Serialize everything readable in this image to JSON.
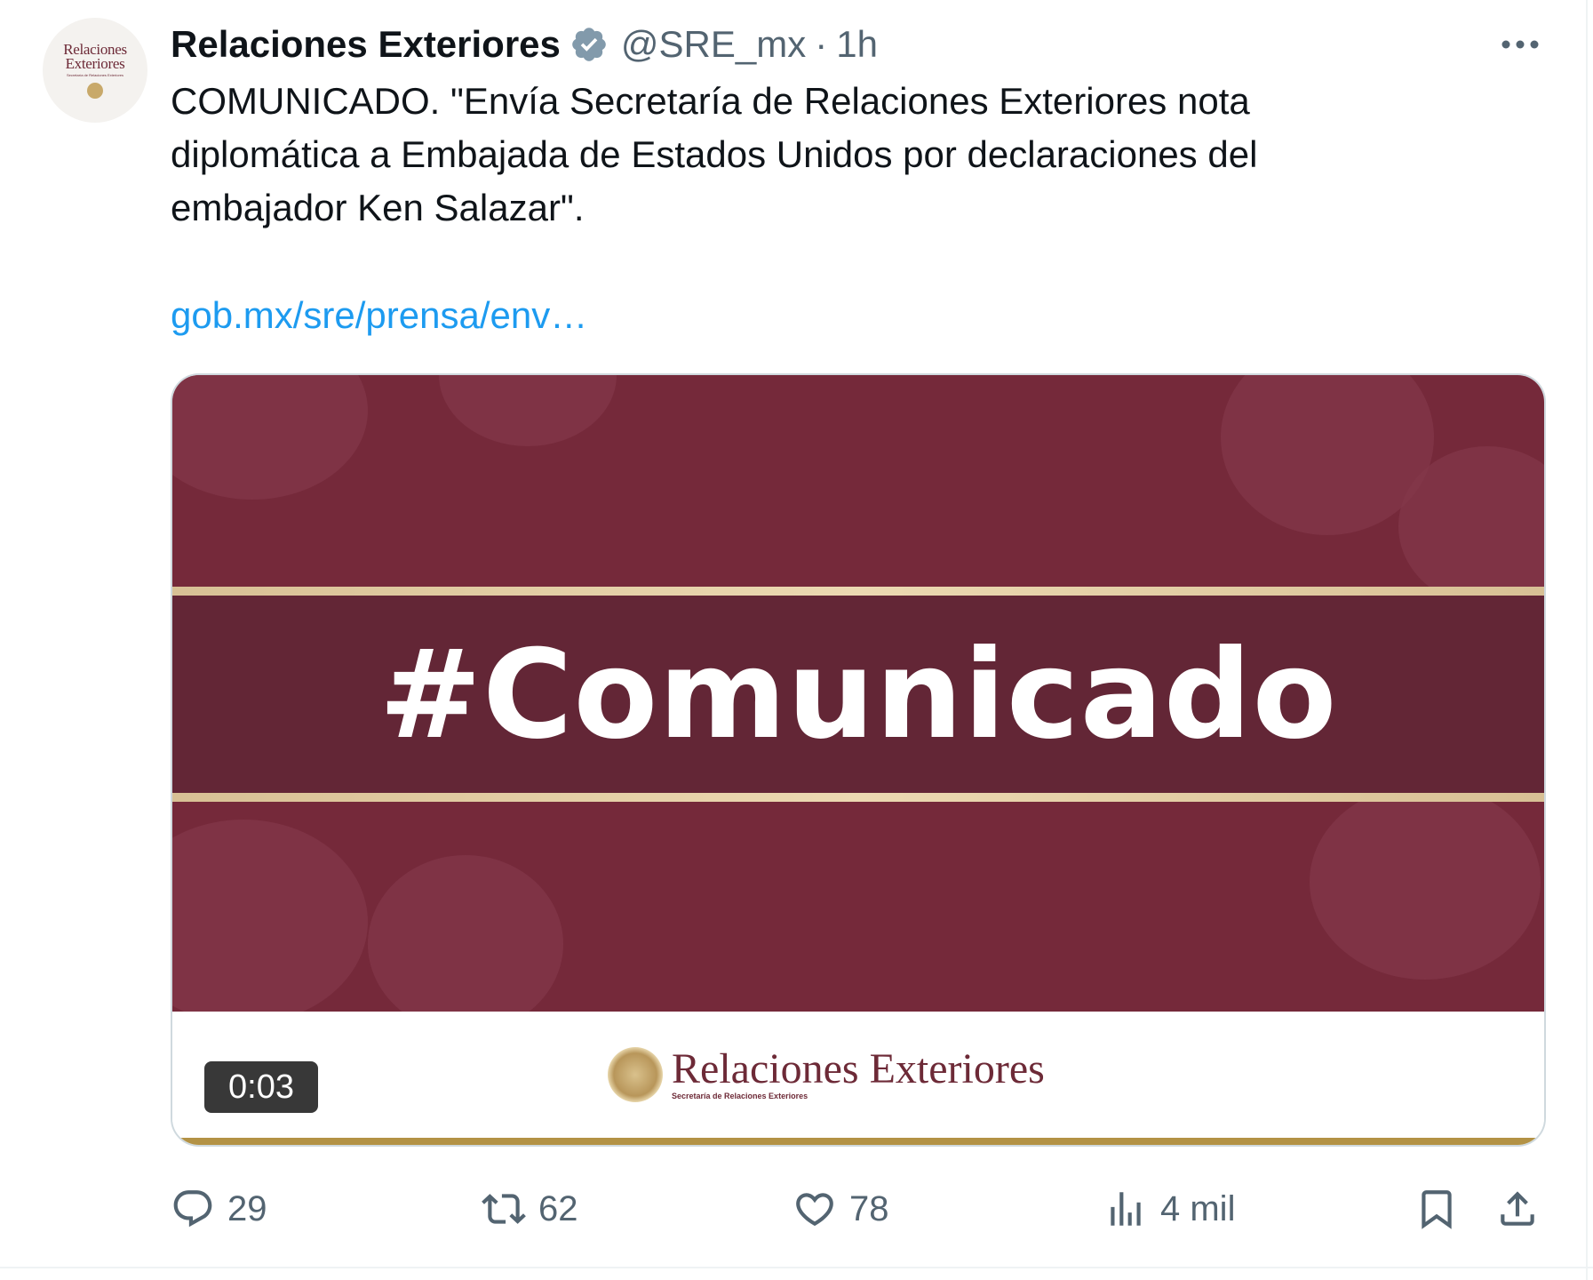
{
  "tweet": {
    "avatar": {
      "line1": "Relaciones",
      "line2": "Exteriores",
      "subtitle": "Secretaría de Relaciones Exteriores"
    },
    "display_name": "Relaciones Exteriores",
    "verified_icon": "verified-badge-icon",
    "handle": "@SRE_mx",
    "separator": "·",
    "time": "1h",
    "more_icon": "more-icon",
    "text": "COMUNICADO. \"Envía Secretaría de Relaciones Exteriores nota diplomática a Embajada de Estados Unidos por declaraciones del embajador Ken Salazar\".",
    "link": "gob.mx/sre/prensa/env…"
  },
  "media": {
    "headline": "#Comunicado",
    "brand_name": "Relaciones Exteriores",
    "brand_sub": "Secretaría de Relaciones Exteriores",
    "timer": "0:03",
    "colors": {
      "maroon": "#75293a",
      "band": "#632636",
      "gold": "#d8c095",
      "gold_bar": "#b39245"
    }
  },
  "actions": {
    "reply": {
      "icon": "reply-icon",
      "count": "29"
    },
    "retweet": {
      "icon": "retweet-icon",
      "count": "62"
    },
    "like": {
      "icon": "heart-icon",
      "count": "78"
    },
    "views": {
      "icon": "views-icon",
      "count": "4 mil"
    },
    "bookmark": {
      "icon": "bookmark-icon"
    },
    "share": {
      "icon": "share-icon"
    }
  },
  "colors": {
    "text": "#0f1419",
    "secondary": "#536471",
    "link": "#1d9bf0",
    "verified": "#829aab"
  }
}
